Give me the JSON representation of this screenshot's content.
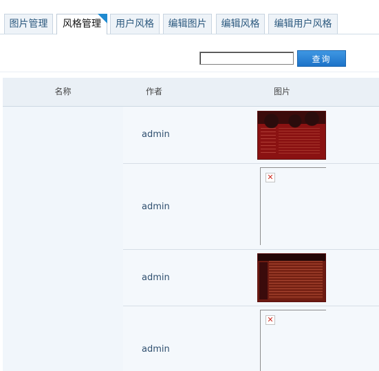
{
  "tabs": [
    {
      "label": "图片管理",
      "active": false
    },
    {
      "label": "风格管理",
      "active": true
    },
    {
      "label": "用户风格",
      "active": false
    },
    {
      "label": "编辑图片",
      "active": false
    },
    {
      "label": "编辑风格",
      "active": false
    },
    {
      "label": "编辑用户风格",
      "active": false
    }
  ],
  "search": {
    "value": "",
    "placeholder": "",
    "button_label": "查询"
  },
  "table": {
    "headers": {
      "name": "名称",
      "author": "作者",
      "image": "图片"
    },
    "rows": [
      {
        "name": "",
        "author": "admin",
        "image": "thumbnail-dark-red-theme",
        "image_loaded": true
      },
      {
        "name": "",
        "author": "admin",
        "image": "broken-image-icon",
        "image_loaded": false
      },
      {
        "name": "",
        "author": "admin",
        "image": "thumbnail-red-brown-theme",
        "image_loaded": true
      },
      {
        "name": "",
        "author": "admin",
        "image": "broken-image-icon",
        "image_loaded": false
      }
    ]
  },
  "colors": {
    "tab_corner_accent": "#1f8ad0",
    "button_blue": "#1d73c8",
    "table_bg": "#f4f8fc"
  }
}
